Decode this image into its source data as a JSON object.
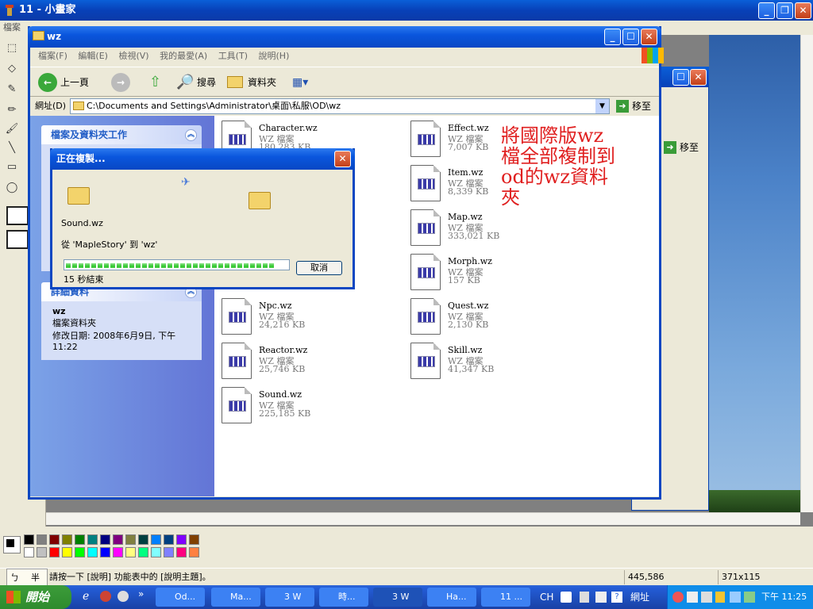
{
  "paint": {
    "title": "11 - 小畫家",
    "menu_first": "檔案",
    "status_help": "請按一下 [說明] 功能表中的 [說明主題]。",
    "status_coords": "445,586",
    "status_size": "371x115",
    "ime_label_1": "ㄅ",
    "ime_label_2": "半"
  },
  "explorer": {
    "title": "wz",
    "menu": [
      "檔案(F)",
      "編輯(E)",
      "檢視(V)",
      "我的最愛(A)",
      "工具(T)",
      "說明(H)"
    ],
    "toolbar": {
      "back": "上一頁",
      "search": "搜尋",
      "folders": "資料夾"
    },
    "address_label": "網址(D)",
    "address": "C:\\Documents and Settings\\Administrator\\桌面\\私服\\OD\\wz",
    "go": "移至",
    "tasks_header": "檔案及資料夾工作",
    "details_header": "詳細資料",
    "details_name": "wz",
    "details_type": "檔案資料夾",
    "details_modified": "修改日期: 2008年6月9日, 下午 11:22",
    "files": [
      {
        "name": "Character.wz",
        "type": "WZ 檔案",
        "size": "180,283 KB"
      },
      {
        "name": "Effect.wz",
        "type": "WZ 檔案",
        "size": "7,007 KB"
      },
      {
        "name": "Item.wz",
        "type": "WZ 檔案",
        "size": "8,339 KB"
      },
      {
        "name": "Map.wz",
        "type": "WZ 檔案",
        "size": "333,021 KB"
      },
      {
        "name": "Morph.wz",
        "type": "WZ 檔案",
        "size": "157 KB"
      },
      {
        "name": "Npc.wz",
        "type": "WZ 檔案",
        "size": "24,216 KB"
      },
      {
        "name": "Quest.wz",
        "type": "WZ 檔案",
        "size": "2,130 KB"
      },
      {
        "name": "Reactor.wz",
        "type": "WZ 檔案",
        "size": "25,746 KB"
      },
      {
        "name": "Skill.wz",
        "type": "WZ 檔案",
        "size": "41,347 KB"
      },
      {
        "name": "Sound.wz",
        "type": "WZ 檔案",
        "size": "225,185 KB"
      }
    ]
  },
  "bg_window": {
    "go": "移至"
  },
  "annotation": "將國際版wz檔全部複制到od的wz資料夾",
  "copy_dialog": {
    "title": "正在複製...",
    "file": "Sound.wz",
    "from_to": "從 'MapleStory' 到 'wz'",
    "remaining": "15 秒結束",
    "cancel": "取消",
    "progress": 0.95
  },
  "taskbar": {
    "start": "開始",
    "items": [
      "Od...",
      "Ma...",
      "3 W",
      "時...",
      "3 W",
      "Ha...",
      "11 ..."
    ],
    "lang": "CH",
    "address": "網址",
    "clock": "下午 11:25"
  },
  "colors": {
    "title_blue": "#0a56dd",
    "annotation_red": "#e02020",
    "progress_green": "#2ec52b",
    "start_green": "#3c9c3a"
  }
}
